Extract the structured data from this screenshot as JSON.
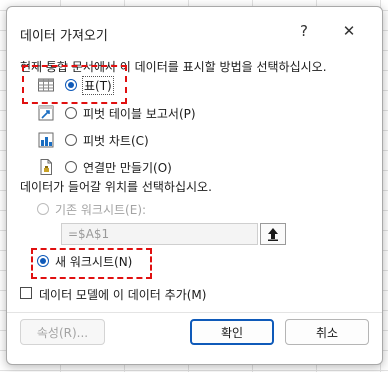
{
  "dialog": {
    "title": "데이터 가져오기",
    "help_symbol": "?",
    "close_symbol": "✕"
  },
  "section1": {
    "prompt": "현재 통합 문서에서 이 데이터를 표시할 방법을 선택하십시오.",
    "options": [
      {
        "label": "표(T)",
        "icon": "table-icon",
        "selected": true
      },
      {
        "label": "피벗 테이블 보고서(P)",
        "icon": "pivot-table-icon",
        "selected": false
      },
      {
        "label": "피벗 차트(C)",
        "icon": "pivot-chart-icon",
        "selected": false
      },
      {
        "label": "연결만 만들기(O)",
        "icon": "connection-only-icon",
        "selected": false
      }
    ]
  },
  "section2": {
    "prompt": "데이터가 들어갈 위치를 선택하십시오.",
    "existing_label": "기존 워크시트(E):",
    "existing_enabled": false,
    "range_value": "=$A$1",
    "new_label": "새 워크시트(N)",
    "new_selected": true
  },
  "data_model": {
    "label": "데이터 모델에 이 데이터 추가(M)",
    "checked": false
  },
  "buttons": {
    "properties": "속성(R)...",
    "ok": "확인",
    "cancel": "취소"
  },
  "colors": {
    "accent": "#0f5ab9",
    "highlight_dash": "#e01010"
  }
}
